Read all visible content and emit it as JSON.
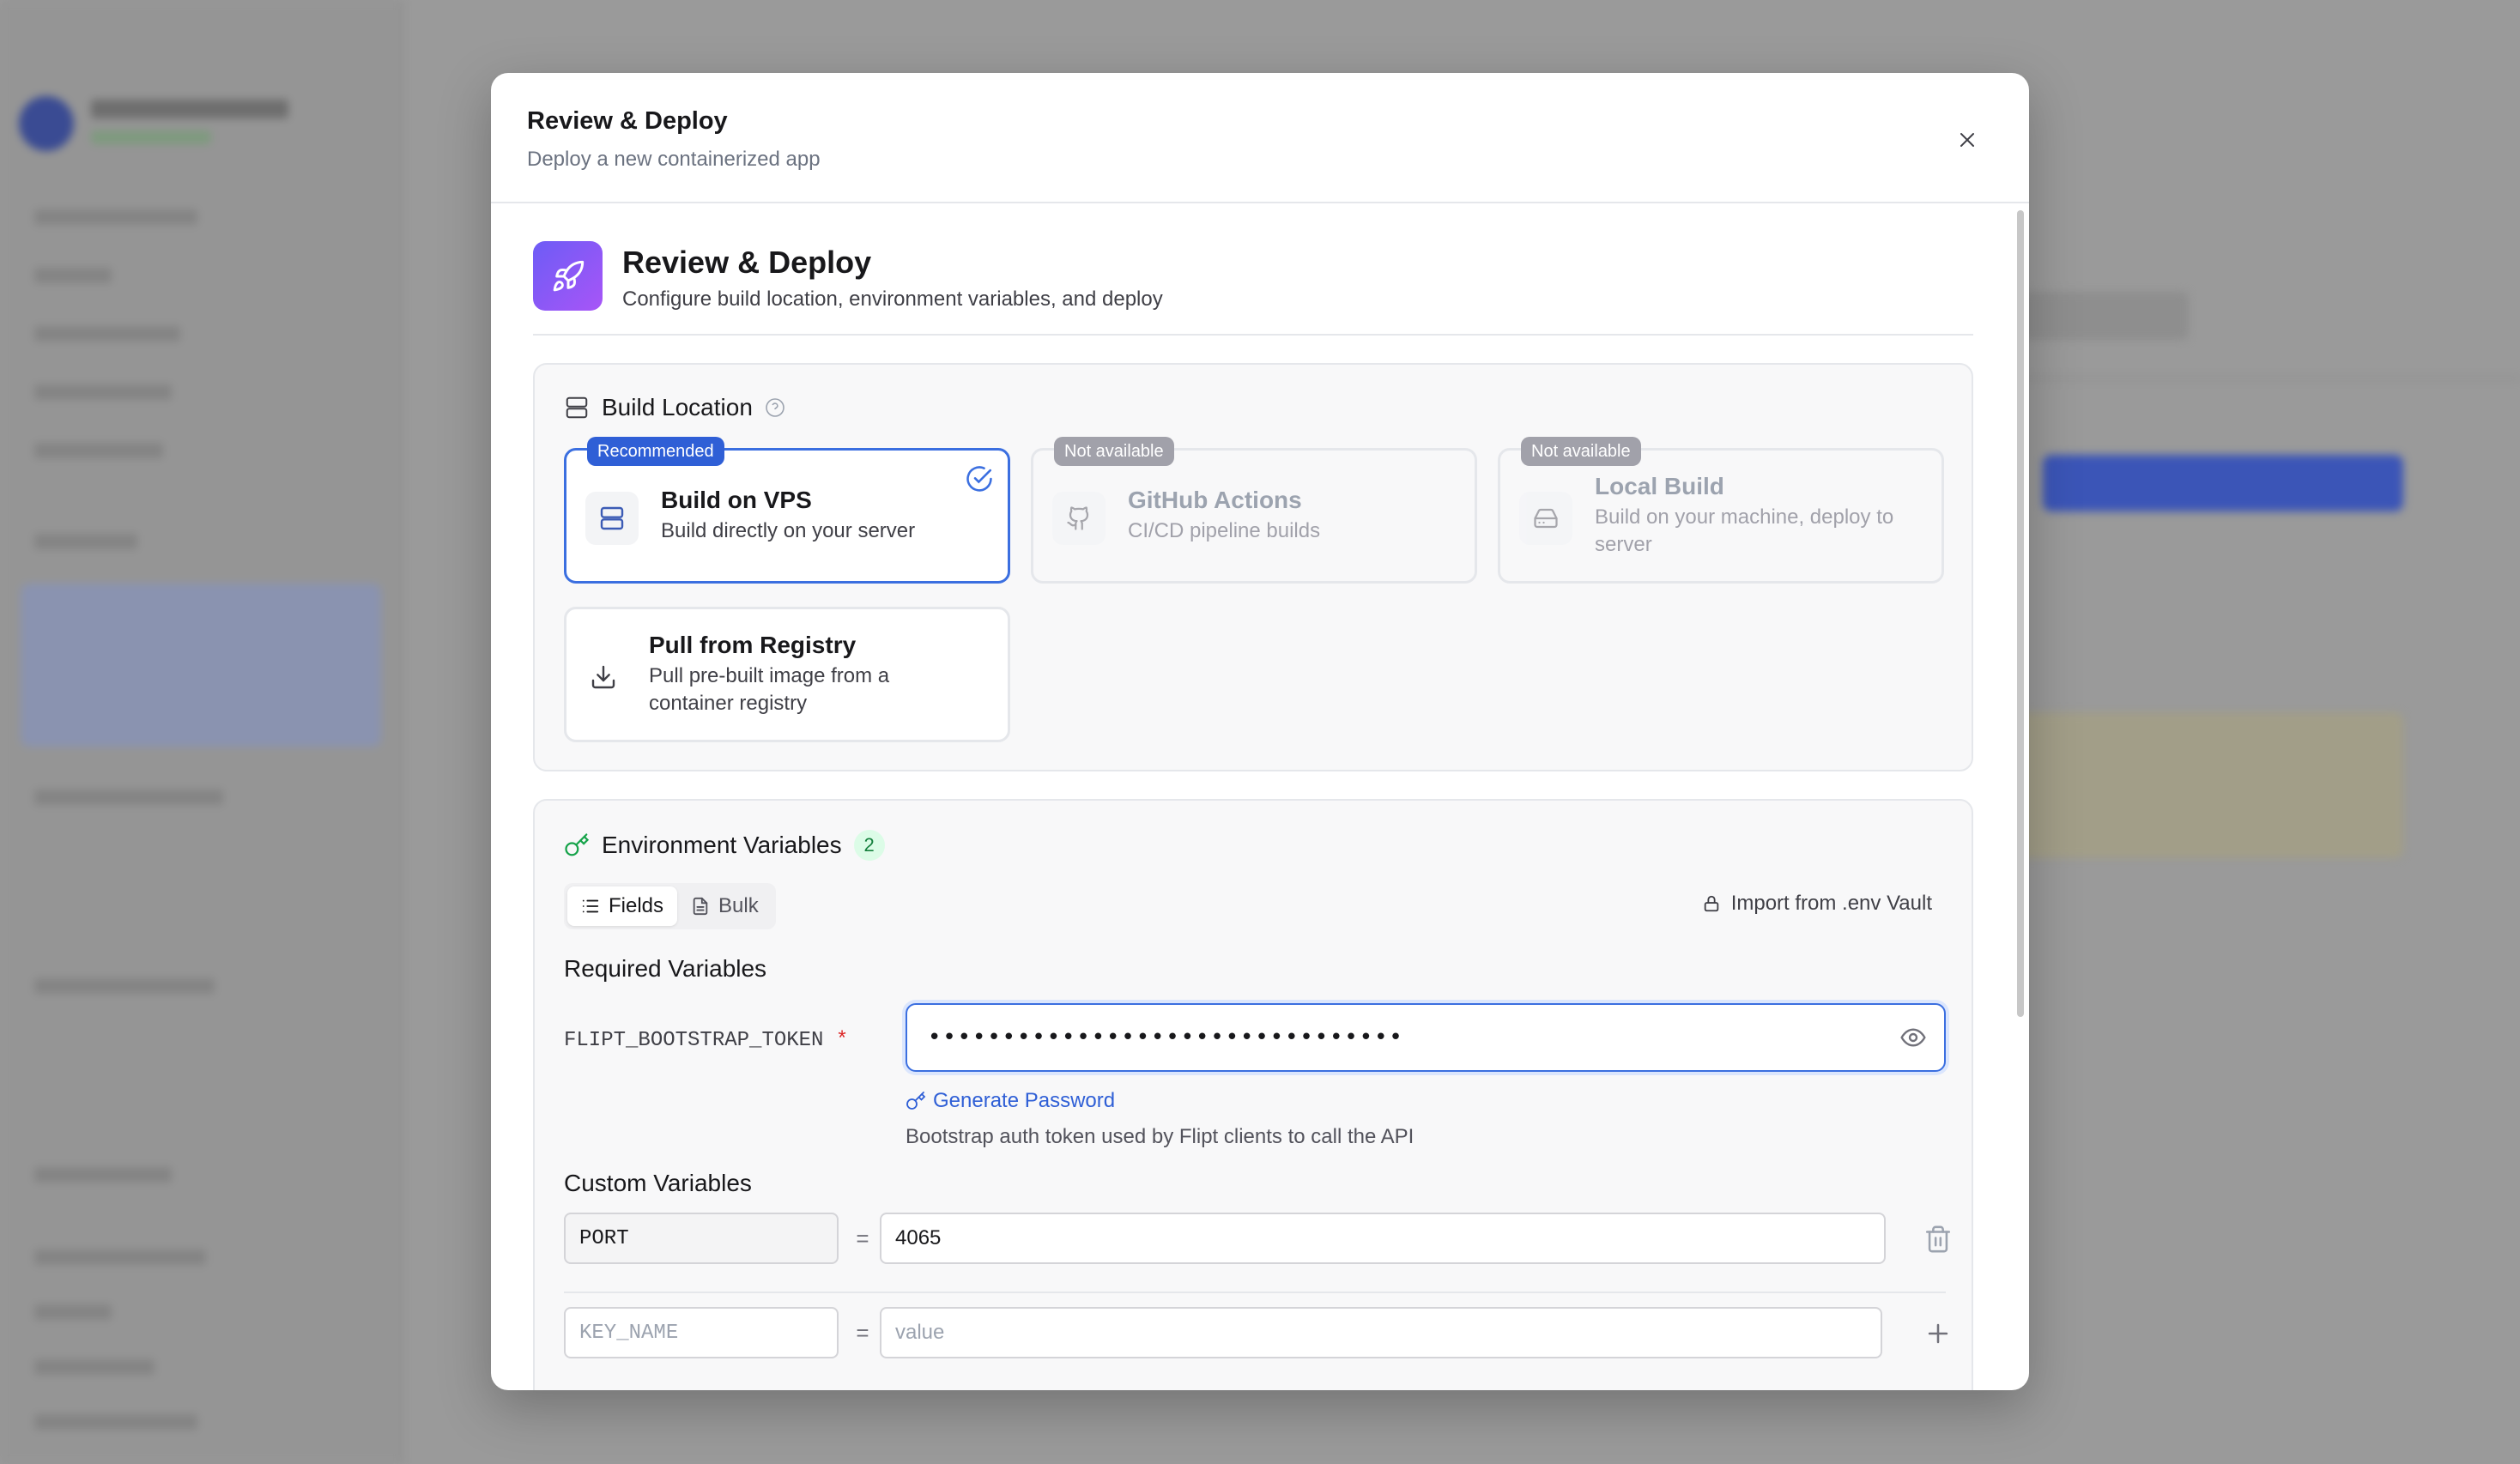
{
  "modal": {
    "title": "Review & Deploy",
    "subtitle": "Deploy a new containerized app"
  },
  "hero": {
    "title": "Review & Deploy",
    "subtitle": "Configure build location, environment variables, and deploy",
    "icon": "rocket-icon"
  },
  "build_location": {
    "title": "Build Location",
    "options": [
      {
        "name": "Build on VPS",
        "desc": "Build directly on your server",
        "badge": "Recommended",
        "selected": true,
        "available": true,
        "icon": "server-icon"
      },
      {
        "name": "GitHub Actions",
        "desc": "CI/CD pipeline builds",
        "badge": "Not available",
        "selected": false,
        "available": false,
        "icon": "github-icon"
      },
      {
        "name": "Local Build",
        "desc": "Build on your machine, deploy to server",
        "badge": "Not available",
        "selected": false,
        "available": false,
        "icon": "hard-drive-icon"
      },
      {
        "name": "Pull from Registry",
        "desc": "Pull pre-built image from a container registry",
        "badge": "",
        "selected": false,
        "available": true,
        "icon": "download-icon"
      }
    ]
  },
  "env": {
    "title": "Environment Variables",
    "count": "2",
    "tabs": [
      {
        "label": "Fields",
        "active": true
      },
      {
        "label": "Bulk",
        "active": false
      }
    ],
    "import_label": "Import from .env Vault",
    "required_heading": "Required Variables",
    "required": {
      "key": "FLIPT_BOOTSTRAP_TOKEN",
      "required_mark": "*",
      "masked_value": "••••••••••••••••••••••••••••••••",
      "generate_label": "Generate Password",
      "hint": "Bootstrap auth token used by Flipt clients to call the API"
    },
    "custom_heading": "Custom Variables",
    "custom": [
      {
        "key": "PORT",
        "value": "4065"
      }
    ],
    "new_row": {
      "key_placeholder": "KEY_NAME",
      "value_placeholder": "value",
      "separator": "="
    }
  },
  "colors": {
    "accent": "#3b6fe0",
    "badge_blue": "#2f5fd6",
    "env_count_bg": "#dcfce7",
    "required_star": "#dc2626"
  }
}
